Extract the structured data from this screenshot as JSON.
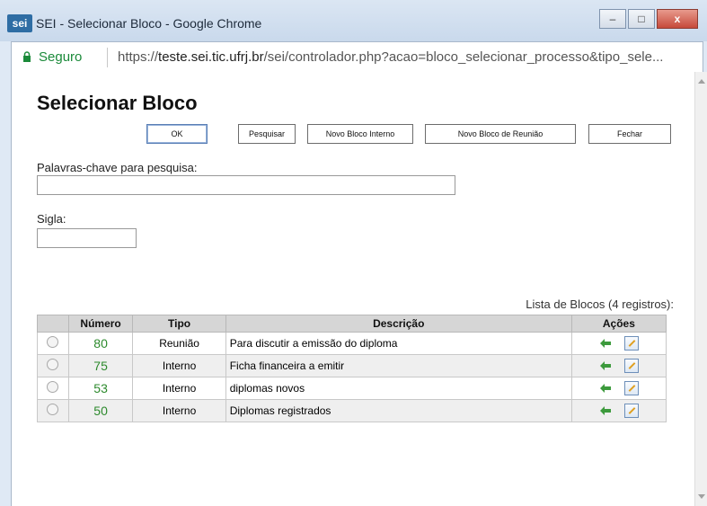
{
  "window": {
    "logo_text": "sei",
    "title": "SEI - Selecionar Bloco - Google Chrome",
    "controls": {
      "minimize": "–",
      "maximize": "□",
      "close": "x"
    }
  },
  "addressbar": {
    "secure_label": "Seguro",
    "url_scheme": "https://",
    "url_domain": "teste.sei.tic.ufrj.br",
    "url_path": "/sei/controlador.php?acao=bloco_selecionar_processo&tipo_sele..."
  },
  "page": {
    "title": "Selecionar Bloco",
    "buttons": {
      "ok": "OK",
      "pesquisar": "Pesquisar",
      "novo_interno": "Novo Bloco Interno",
      "novo_reuniao": "Novo Bloco de Reunião",
      "fechar": "Fechar"
    },
    "keywords_label": "Palavras-chave para pesquisa:",
    "keywords_value": "",
    "sigla_label": "Sigla:",
    "sigla_value": "",
    "table_caption": "Lista de Blocos (4 registros):",
    "columns": [
      "",
      "Número",
      "Tipo",
      "Descrição",
      "Ações"
    ],
    "rows": [
      {
        "numero": "80",
        "tipo": "Reunião",
        "descricao": "Para discutir a emissão do diploma"
      },
      {
        "numero": "75",
        "tipo": "Interno",
        "descricao": "Ficha financeira a emitir"
      },
      {
        "numero": "53",
        "tipo": "Interno",
        "descricao": "diplomas novos"
      },
      {
        "numero": "50",
        "tipo": "Interno",
        "descricao": "Diplomas registrados"
      }
    ]
  },
  "colors": {
    "secure_green": "#1b8a3a",
    "number_green": "#2d8a2d",
    "header_gray": "#d6d6d6",
    "close_red": "#c64a3b"
  }
}
